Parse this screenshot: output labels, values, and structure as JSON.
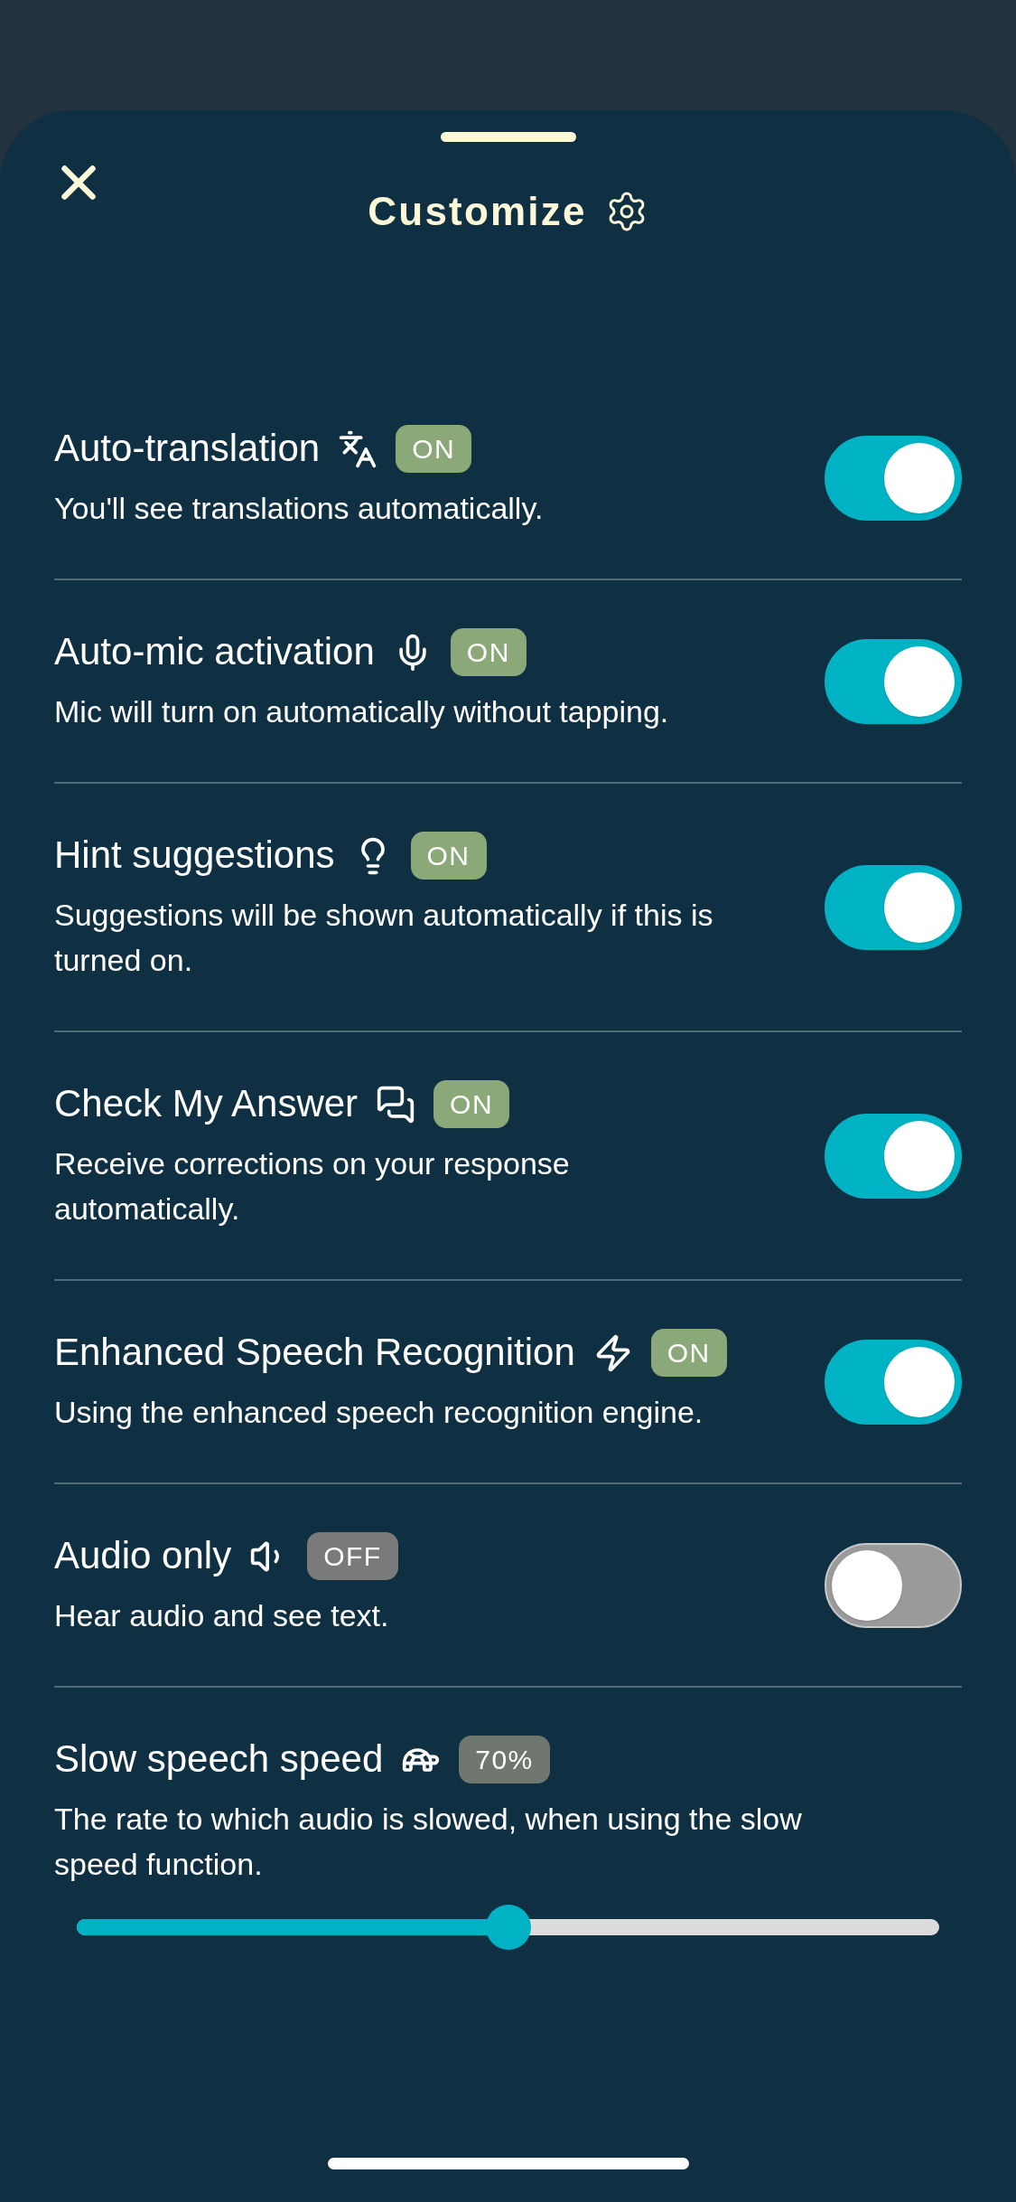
{
  "header": {
    "title": "Customize"
  },
  "settings": [
    {
      "kind": "toggle",
      "title": "Auto-translation",
      "badge": "ON",
      "on": true,
      "description": "You'll see translations automatically."
    },
    {
      "kind": "toggle",
      "title": "Auto-mic activation",
      "badge": "ON",
      "on": true,
      "description": "Mic will turn on automatically without tapping."
    },
    {
      "kind": "toggle",
      "title": "Hint suggestions",
      "badge": "ON",
      "on": true,
      "description": "Suggestions will be shown automatically if this is turned on."
    },
    {
      "kind": "toggle",
      "title": "Check My Answer",
      "badge": "ON",
      "on": true,
      "description": "Receive corrections on your response automatically."
    },
    {
      "kind": "toggle",
      "title": "Enhanced Speech Recognition",
      "badge": "ON",
      "on": true,
      "description": "Using the enhanced speech recognition engine."
    },
    {
      "kind": "toggle",
      "title": "Audio only",
      "badge": "OFF",
      "on": false,
      "description": "Hear audio and see text."
    },
    {
      "kind": "slider",
      "title": "Slow speech speed",
      "badge": "70%",
      "level": 0.5,
      "description": "The rate to which audio is slowed, when using the slow speed function."
    }
  ]
}
